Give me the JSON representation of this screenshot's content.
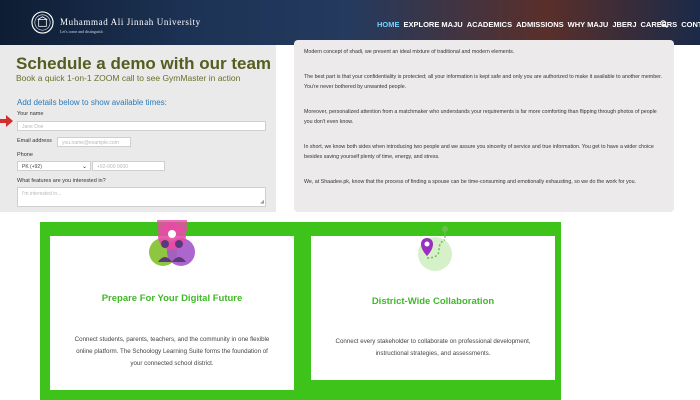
{
  "header": {
    "university_name": "Muhammad Ali Jinnah University",
    "university_subtitle": "Let's come and distinguish",
    "nav_items": [
      {
        "label": "HOME",
        "active": true
      },
      {
        "label": "EXPLORE MAJU",
        "active": false
      },
      {
        "label": "ACADEMICS",
        "active": false
      },
      {
        "label": "ADMISSIONS",
        "active": false
      },
      {
        "label": "WHY MAJU",
        "active": false
      },
      {
        "label": "JBERJ",
        "active": false
      },
      {
        "label": "CAREERS",
        "active": false
      },
      {
        "label": "CONTACT",
        "active": false
      }
    ],
    "search_icon": "search-icon",
    "colors": {
      "active_nav": "#6fd3ff"
    }
  },
  "demo": {
    "title": "Schedule a demo with our team",
    "subtitle": "Book a quick 1-on-1 ZOOM call to see GymMaster in action",
    "form_heading": "Add details below to show available times:",
    "name_label": "Your name",
    "name_placeholder": "Jane Doe",
    "email_label": "Email address",
    "email_placeholder": "you.name@example.com",
    "phone_label": "Phone",
    "phone_country": "PK (+92)",
    "phone_placeholder": "+92-000 0000",
    "features_label": "What features are you interested in?",
    "features_placeholder": "I'm interested in...",
    "colors": {
      "title": "#575c20",
      "heading": "#2d7bb8",
      "arrow": "#d42d2d"
    }
  },
  "panel": {
    "paragraphs": [
      "Modern concept of shadi, we present an ideal mixture of traditional and modern elements.",
      "The best part is that your confidentiality is protected; all your information is kept safe and only you are authorized to make it available to another member. You're never bothered by unwanted people.",
      "Moreover, personalized attention from a matchmaker who understands your requirements is far more comforting than flipping through photos of people you don't even know.",
      "In short, we know both sides when introducing two people and we assure you sincerity of service and true information. You get to have a wider choice besides saving yourself plenty of time, energy, and stress.",
      "We, at Shaadee.pk, know that the process of finding a spouse can be time-consuming and emotionally exhausting, so we do the work for you."
    ]
  },
  "features": {
    "cards": [
      {
        "icon": "people-icon",
        "title": "Prepare For Your Digital Future",
        "text": "Connect students, parents, teachers, and the community in one flexible online platform. The Schoology Learning Suite forms the foundation of your connected school district."
      },
      {
        "icon": "route-pin-icon",
        "title": "District-Wide Collaboration",
        "text": "Connect every stakeholder to collaborate on professional development, instructional strategies, and assessments."
      }
    ],
    "colors": {
      "section_bg": "#3ec31b",
      "title": "#41b82a"
    }
  }
}
